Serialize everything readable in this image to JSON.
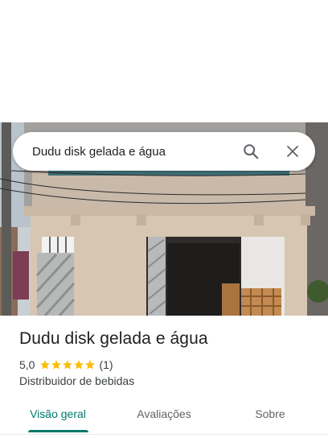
{
  "search": {
    "query": "Dudu disk gelada e água",
    "search_icon": "search-icon",
    "close_icon": "close-icon"
  },
  "place": {
    "name": "Dudu disk gelada e água",
    "rating": "5,0",
    "stars": 5,
    "review_count": "(1)",
    "category": "Distribuidor de bebidas"
  },
  "tabs": [
    {
      "label": "Visão geral",
      "active": true
    },
    {
      "label": "Avaliações",
      "active": false
    },
    {
      "label": "Sobre",
      "active": false
    }
  ],
  "colors": {
    "accent": "#00796b",
    "star": "#fbbc04",
    "text": "#202124",
    "secondary_text": "#3c4043"
  }
}
